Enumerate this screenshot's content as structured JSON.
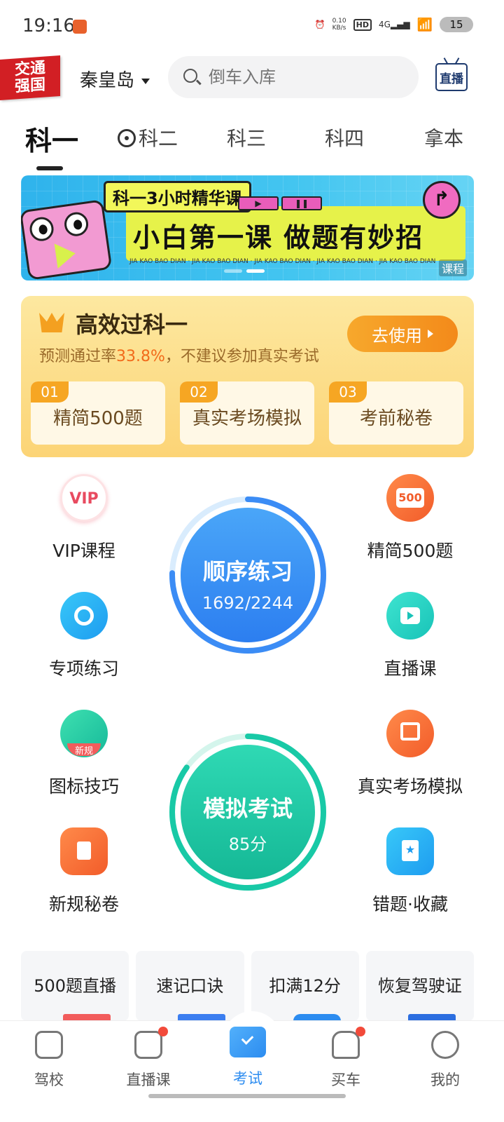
{
  "status_bar": {
    "time": "19:16",
    "network_speed": "0.10\nKB/s",
    "hd": "HD",
    "signal": "4G",
    "battery": "15"
  },
  "header": {
    "logo_text": "交通\n强国",
    "city": "秦皇岛",
    "search_placeholder": "倒车入库",
    "live_label": "直播"
  },
  "subject_tabs": [
    {
      "label": "科一",
      "active": true
    },
    {
      "label": "科二",
      "active": false
    },
    {
      "label": "科三",
      "active": false
    },
    {
      "label": "科四",
      "active": false
    },
    {
      "label": "拿本",
      "active": false
    }
  ],
  "banner": {
    "tag": "科一3小时精华课",
    "headline": "小白第一课 做题有妙招",
    "marquee": "JIA KAO BAO DIAN · JIA KAO BAO DIAN · JIA KAO BAO DIAN · JIA KAO BAO DIAN · JIA KAO BAO DIAN",
    "corner_label": "课程",
    "page_count": 2,
    "current_page": 2
  },
  "vip_card": {
    "title": "高效过科一",
    "subtitle_prefix": "预测通过率",
    "subtitle_rate": "33.8%",
    "subtitle_suffix": "，不建议参加真实考试",
    "use_button": "去使用",
    "chips": [
      {
        "num": "01",
        "label": "精简500题"
      },
      {
        "num": "02",
        "label": "真实考场模拟"
      },
      {
        "num": "03",
        "label": "考前秘卷"
      }
    ]
  },
  "features": {
    "vip_course": "VIP课程",
    "simplified_500": "精简500题",
    "badge_500": "500",
    "special_practice": "专项练习",
    "live_course": "直播课",
    "sign_tips": "图标技巧",
    "new_tag": "新规",
    "real_exam_sim": "真实考场模拟",
    "new_rule_paper": "新规秘卷",
    "mistakes_favorites": "错题·收藏"
  },
  "sequential_practice": {
    "title": "顺序练习",
    "progress_text": "1692/2244",
    "done": 1692,
    "total": 2244
  },
  "mock_exam": {
    "title": "模拟考试",
    "score_text": "85分",
    "score": 85
  },
  "shortcuts": [
    "500题直播",
    "速记口诀",
    "扣满12分",
    "恢复驾驶证"
  ],
  "bottom_nav": [
    {
      "label": "驾校",
      "badge": false
    },
    {
      "label": "直播课",
      "badge": true
    },
    {
      "label": "考试",
      "badge": false,
      "active": true
    },
    {
      "label": "买车",
      "badge": true
    },
    {
      "label": "我的",
      "badge": false
    }
  ],
  "colors": {
    "accent": "#2c8cf0",
    "vip_orange": "#f6a623",
    "practice_blue": "#3b8cf5",
    "exam_green": "#18c9a6"
  }
}
